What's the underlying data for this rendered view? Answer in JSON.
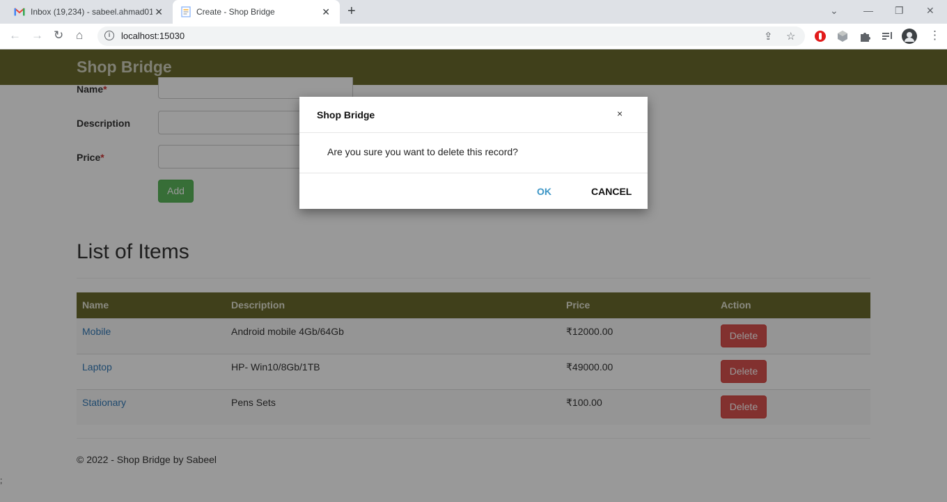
{
  "browser": {
    "tabs": [
      {
        "title": "Inbox (19,234) - sabeel.ahmad01",
        "close": "✕"
      },
      {
        "title": "Create - Shop Bridge",
        "close": "✕"
      }
    ],
    "new_tab": "+",
    "url": "localhost:15030"
  },
  "app": {
    "brand": "Shop Bridge"
  },
  "form": {
    "name_label": "Name",
    "description_label": "Description",
    "price_label": "Price",
    "required_mark": "*",
    "add_label": "Add"
  },
  "list": {
    "title": "List of Items",
    "columns": [
      "Name",
      "Description",
      "Price",
      "Action"
    ],
    "rows": [
      {
        "name": "Mobile",
        "description": "Android mobile 4Gb/64Gb",
        "price": "₹12000.00",
        "action": "Delete"
      },
      {
        "name": "Laptop",
        "description": "HP- Win10/8Gb/1TB",
        "price": "₹49000.00",
        "action": "Delete"
      },
      {
        "name": "Stationary",
        "description": "Pens Sets",
        "price": "₹100.00",
        "action": "Delete"
      }
    ]
  },
  "footer": {
    "text": "© 2022 - Shop Bridge by Sabeel",
    "stray": ";"
  },
  "modal": {
    "title": "Shop Bridge",
    "close": "×",
    "message": "Are you sure you want to delete this record?",
    "ok": "OK",
    "cancel": "CANCEL"
  }
}
